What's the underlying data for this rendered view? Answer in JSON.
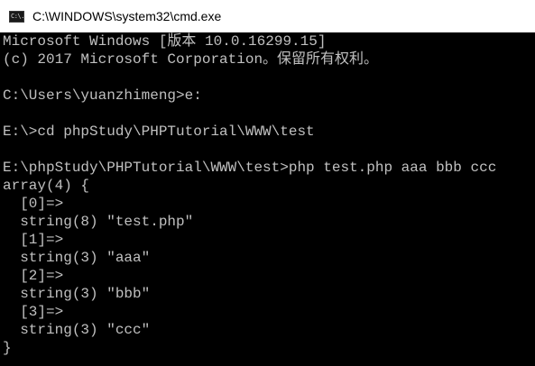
{
  "window": {
    "title": "C:\\WINDOWS\\system32\\cmd.exe",
    "icon": "cmd-console-icon",
    "icon_glyph": "C:\\."
  },
  "console": {
    "lines": [
      "Microsoft Windows [版本 10.0.16299.15]",
      "(c) 2017 Microsoft Corporation。保留所有权利。",
      "",
      "C:\\Users\\yuanzhimeng>e:",
      "",
      "E:\\>cd phpStudy\\PHPTutorial\\WWW\\test",
      "",
      "E:\\phpStudy\\PHPTutorial\\WWW\\test>php test.php aaa bbb ccc",
      "array(4) {",
      "  [0]=>",
      "  string(8) \"test.php\"",
      "  [1]=>",
      "  string(3) \"aaa\"",
      "  [2]=>",
      "  string(3) \"bbb\"",
      "  [3]=>",
      "  string(3) \"ccc\"",
      "}"
    ]
  },
  "colors": {
    "background": "#000000",
    "text": "#c0c0c0",
    "titlebar": "#ffffff"
  }
}
